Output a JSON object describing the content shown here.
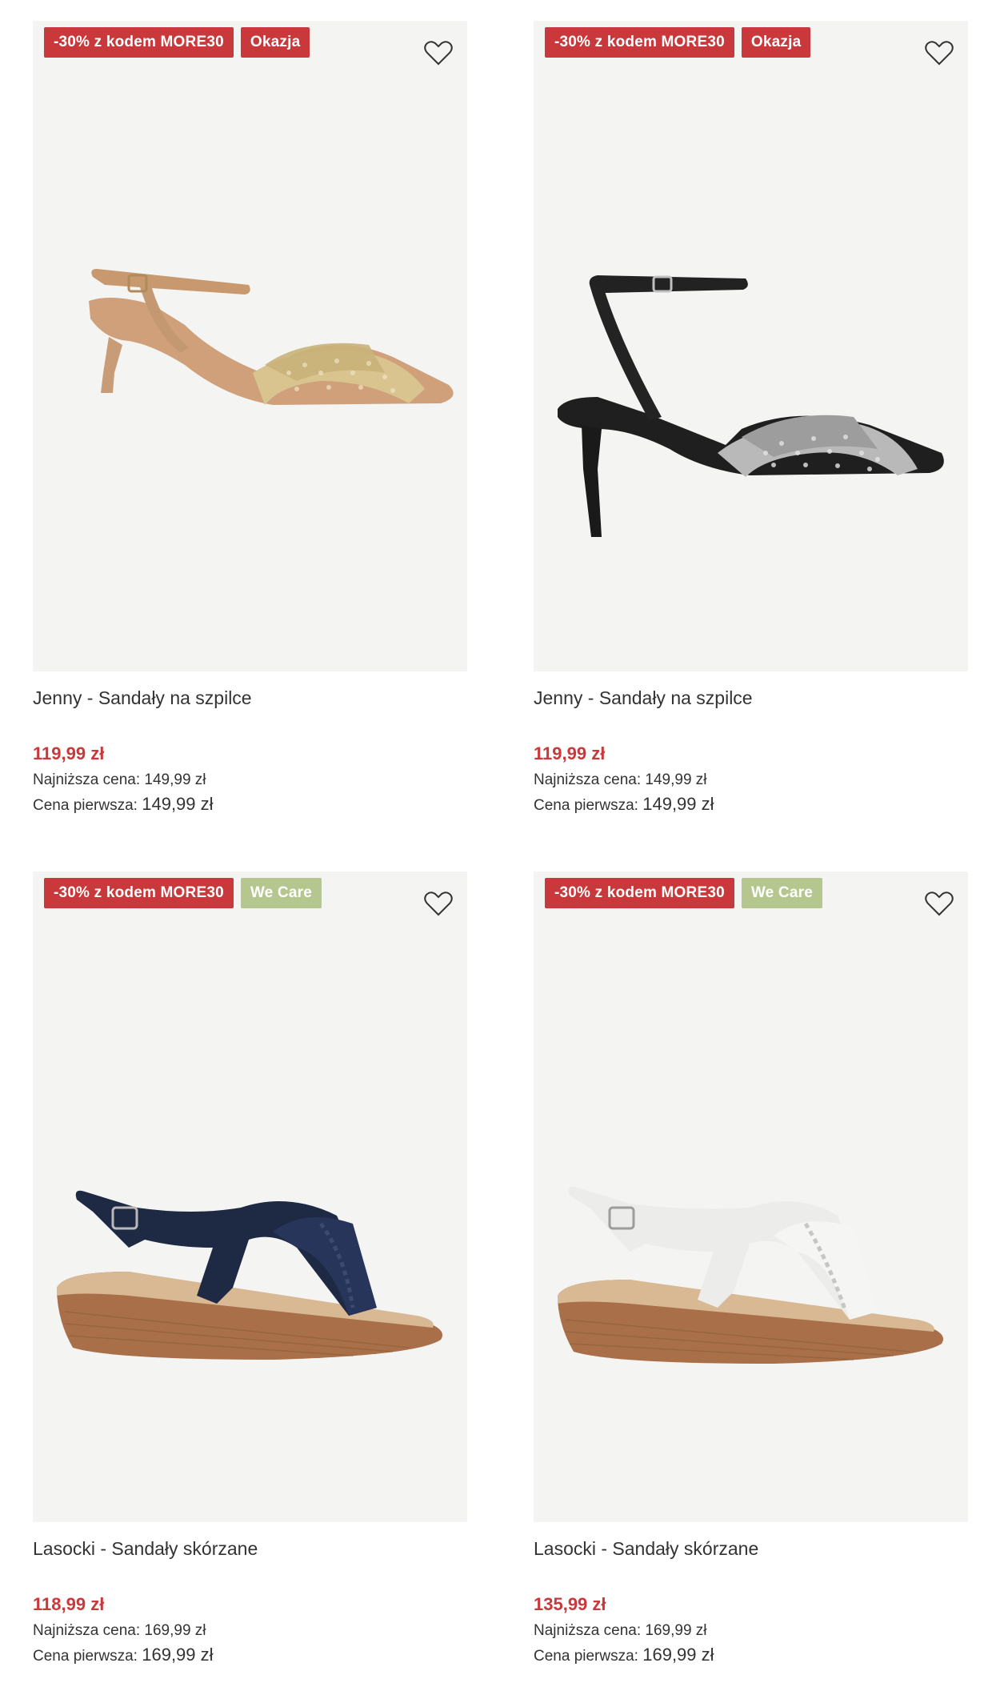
{
  "products": [
    {
      "badges": [
        {
          "label": "-30% z kodem MORE30",
          "kind": "promo"
        },
        {
          "label": "Okazja",
          "kind": "okazja"
        }
      ],
      "name": "Jenny - Sandały na szpilce",
      "price": "119,99 zł",
      "lowest_label": "Najniższa cena:",
      "lowest_value": "149,99 zł",
      "first_label": "Cena pierwsza:",
      "first_value": "149,99 zł",
      "image": "tan-heeled-sandal"
    },
    {
      "badges": [
        {
          "label": "-30% z kodem MORE30",
          "kind": "promo"
        },
        {
          "label": "Okazja",
          "kind": "okazja"
        }
      ],
      "name": "Jenny - Sandały na szpilce",
      "price": "119,99 zł",
      "lowest_label": "Najniższa cena:",
      "lowest_value": "149,99 zł",
      "first_label": "Cena pierwsza:",
      "first_value": "149,99 zł",
      "image": "black-heeled-sandal"
    },
    {
      "badges": [
        {
          "label": "-30% z kodem MORE30",
          "kind": "promo"
        },
        {
          "label": "We Care",
          "kind": "wecare"
        }
      ],
      "name": "Lasocki - Sandały skórzane",
      "price": "118,99 zł",
      "lowest_label": "Najniższa cena:",
      "lowest_value": "169,99 zł",
      "first_label": "Cena pierwsza:",
      "first_value": "169,99 zł",
      "image": "navy-wedge-sandal"
    },
    {
      "badges": [
        {
          "label": "-30% z kodem MORE30",
          "kind": "promo"
        },
        {
          "label": "We Care",
          "kind": "wecare"
        }
      ],
      "name": "Lasocki - Sandały skórzane",
      "price": "135,99 zł",
      "lowest_label": "Najniższa cena:",
      "lowest_value": "169,99 zł",
      "first_label": "Cena pierwsza:",
      "first_value": "169,99 zł",
      "image": "white-wedge-sandal"
    }
  ],
  "icons": {
    "wishlist": "heart-outline-icon"
  },
  "colors": {
    "promo": "#c9393b",
    "wecare": "#b5c78e",
    "price": "#c9393b",
    "image_bg": "#f4f4f3"
  }
}
